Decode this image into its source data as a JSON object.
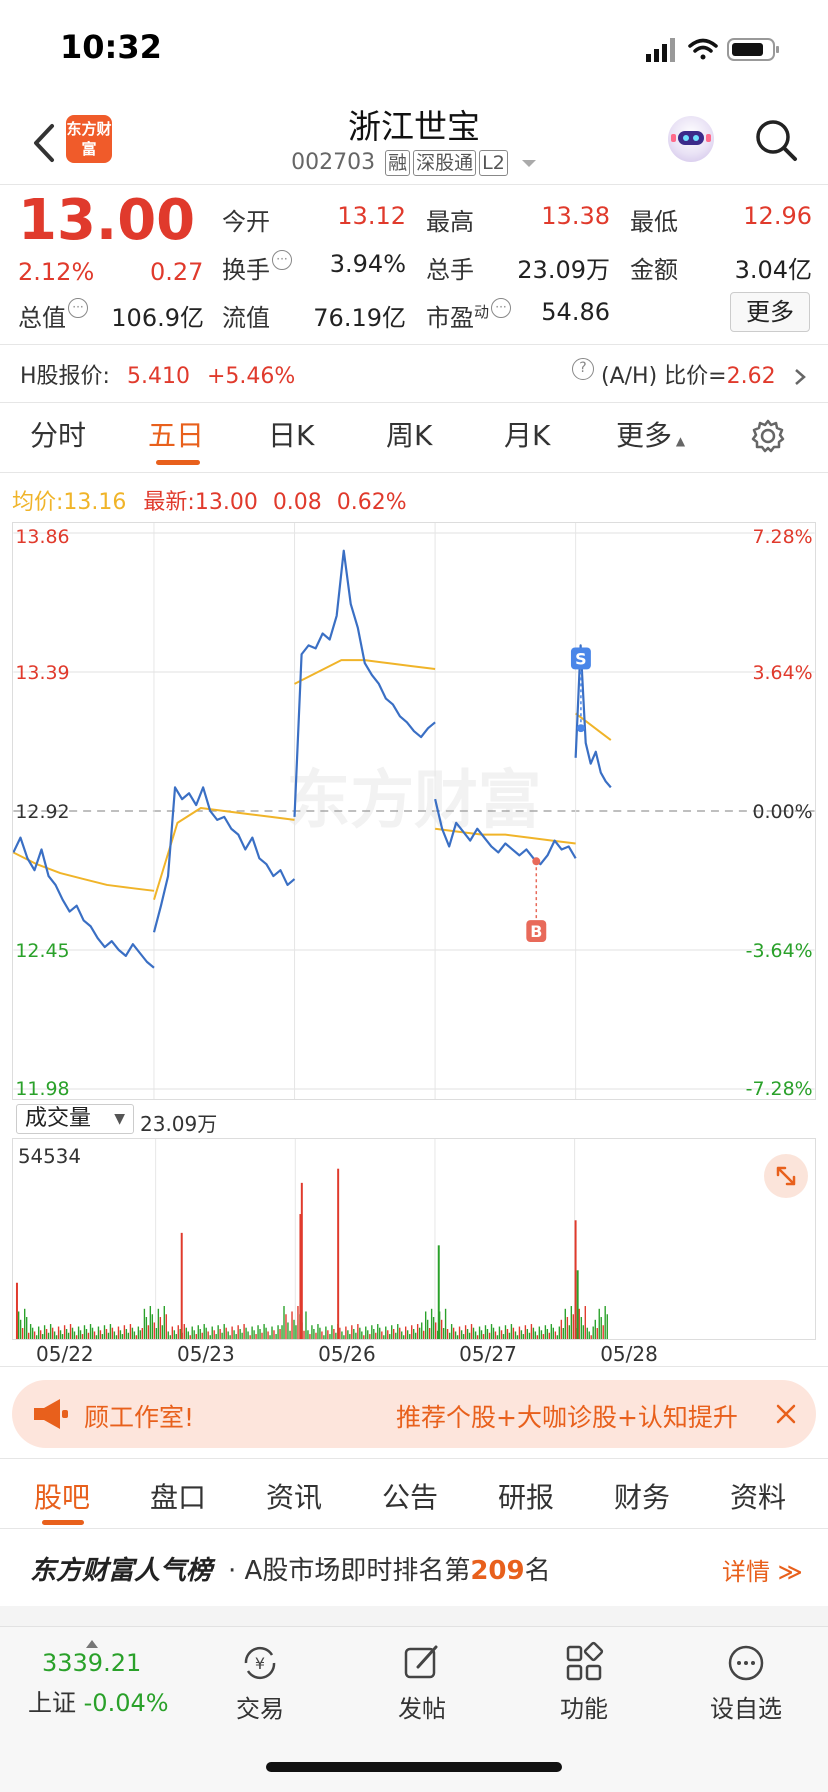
{
  "status": {
    "time": "10:32"
  },
  "header": {
    "logo_text": "东方财富",
    "name": "浙江世宝",
    "code": "002703",
    "tags": [
      "融",
      "深股通",
      "L2"
    ]
  },
  "quote": {
    "price": "13.00",
    "pct": "2.12%",
    "change": "0.27",
    "open_label": "今开",
    "open": "13.12",
    "high_label": "最高",
    "high": "13.38",
    "low_label": "最低",
    "low": "12.96",
    "turnover_label": "换手",
    "turnover": "3.94%",
    "volume_label": "总手",
    "volume": "23.09万",
    "amount_label": "金额",
    "amount": "3.04亿",
    "mktcap_label": "总值",
    "mktcap": "106.9亿",
    "float_label": "流值",
    "float": "76.19亿",
    "pe_label": "市盈",
    "pe_sup": "动",
    "pe": "54.86",
    "more": "更多"
  },
  "hk": {
    "label": "H股报价:",
    "price": "5.410",
    "pct": "+5.46%",
    "ah_label": "(A/H) 比价=",
    "ah_value": "2.62"
  },
  "tabs": [
    "分时",
    "五日",
    "日K",
    "周K",
    "月K",
    "更多"
  ],
  "legend": {
    "avg_label": "均价:",
    "avg": "13.16",
    "latest_label": "最新:",
    "latest": "13.00",
    "change": "0.08",
    "pct": "0.62%"
  },
  "watermark": "东方财富",
  "chart_data": {
    "type": "line",
    "title": "",
    "x_labels": [
      "05/22",
      "05/23",
      "05/26",
      "05/27",
      "05/28"
    ],
    "y_labels_left": [
      "13.86",
      "13.39",
      "12.92",
      "12.45",
      "11.98"
    ],
    "y_labels_right": [
      "7.28%",
      "3.64%",
      "0.00%",
      "-3.64%",
      "-7.28%"
    ],
    "ylim": [
      11.98,
      13.86
    ],
    "prev_close": 12.92,
    "series": [
      {
        "name": "最新",
        "color": "#3a6fc4",
        "days": [
          [
            12.78,
            12.83,
            12.76,
            12.72,
            12.79,
            12.7,
            12.67,
            12.62,
            12.58,
            12.6,
            12.55,
            12.53,
            12.49,
            12.46,
            12.48,
            12.45,
            12.43,
            12.47,
            12.44,
            12.41,
            12.39
          ],
          [
            12.51,
            12.6,
            12.7,
            13.0,
            12.96,
            12.98,
            12.94,
            13.0,
            12.92,
            12.89,
            12.9,
            12.86,
            12.84,
            12.79,
            12.83,
            12.76,
            12.74,
            12.7,
            12.72,
            12.67,
            12.69
          ],
          [
            12.9,
            13.45,
            13.48,
            13.47,
            13.52,
            13.5,
            13.58,
            13.8,
            13.62,
            13.54,
            13.42,
            13.38,
            13.35,
            13.3,
            13.28,
            13.24,
            13.22,
            13.19,
            13.17,
            13.2,
            13.22
          ],
          [
            12.96,
            12.86,
            12.8,
            12.88,
            12.85,
            12.82,
            12.86,
            12.83,
            12.8,
            12.78,
            12.81,
            12.79,
            12.77,
            12.79,
            12.76,
            12.74,
            12.77,
            12.82,
            12.79,
            12.8,
            12.76
          ],
          [
            13.1,
            13.48,
            13.15,
            13.08,
            13.12,
            13.05,
            13.02,
            13.0
          ]
        ]
      },
      {
        "name": "均价",
        "color": "#f0b429",
        "days": [
          [
            12.78,
            12.74,
            12.71,
            12.69,
            12.67,
            12.66,
            12.65
          ],
          [
            12.62,
            12.88,
            12.93,
            12.92,
            12.91,
            12.9,
            12.89
          ],
          [
            13.35,
            13.39,
            13.43,
            13.43,
            13.42,
            13.41,
            13.4
          ],
          [
            12.86,
            12.85,
            12.84,
            12.84,
            12.83,
            12.82,
            12.81
          ],
          [
            13.25,
            13.22,
            13.19,
            13.16
          ]
        ]
      }
    ],
    "markers": [
      {
        "label": "S",
        "day": 4,
        "at": 0.15,
        "price": 13.2,
        "color": "#4a86e8"
      },
      {
        "label": "B",
        "day": 3,
        "at": 0.72,
        "price": 12.75,
        "color": "#e86a5a"
      }
    ],
    "volume": {
      "label": "成交量",
      "total": "23.09万",
      "max_label": "54534",
      "ymax": 54534,
      "spikes": [
        {
          "day": 0,
          "at": 0.0,
          "value": 18000,
          "color": "#e03a2c"
        },
        {
          "day": 1,
          "at": 0.18,
          "value": 34000,
          "color": "#e03a2c"
        },
        {
          "day": 2,
          "at": 0.03,
          "value": 40000,
          "color": "#e03a2c"
        },
        {
          "day": 2,
          "at": 0.04,
          "value": 50000,
          "color": "#e03a2c"
        },
        {
          "day": 2,
          "at": 0.3,
          "value": 54534,
          "color": "#e03a2c"
        },
        {
          "day": 3,
          "at": 0.02,
          "value": 30000,
          "color": "#2aa12a"
        },
        {
          "day": 4,
          "at": 0.0,
          "value": 38000,
          "color": "#e03a2c"
        },
        {
          "day": 4,
          "at": 0.06,
          "value": 22000,
          "color": "#2aa12a"
        }
      ],
      "baseline_level": 4000
    }
  },
  "banner": {
    "left_text": "顾工作室!",
    "right_text": "推荐个股+大咖诊股+认知提升"
  },
  "tabs2": [
    "股吧",
    "盘口",
    "资讯",
    "公告",
    "研报",
    "财务",
    "资料"
  ],
  "rank": {
    "brand": "东方财富人气榜",
    "text": "A股市场即时排名第",
    "rank": "209",
    "suffix": "名",
    "link": "详情"
  },
  "bottom": {
    "index_value": "3339.21",
    "index_name": "上证",
    "index_pct": "-0.04%",
    "items": [
      "交易",
      "发帖",
      "功能",
      "设自选"
    ]
  }
}
